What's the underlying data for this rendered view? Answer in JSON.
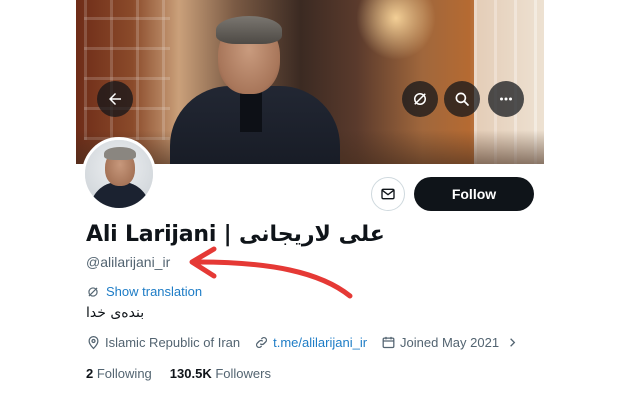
{
  "banner": {
    "back_icon": "back-arrow-icon",
    "icons": [
      "translate-off-icon",
      "search-icon",
      "more-icon"
    ]
  },
  "profile": {
    "display_name": "Ali Larijani | علی لاریجانی",
    "handle": "@alilarijani_ir",
    "show_translation": "Show translation",
    "bio": "بنده‌ی خدا",
    "location": "Islamic Republic of Iran",
    "link": "t.me/alilarijani_ir",
    "joined": "Joined May 2021"
  },
  "actions": {
    "follow_label": "Follow",
    "message_icon": "mail-icon"
  },
  "stats": {
    "following_count": "2",
    "following_label": "Following",
    "followers_count": "130.5K",
    "followers_label": "Followers"
  },
  "annotation": {
    "arrow_color": "#e53935"
  }
}
